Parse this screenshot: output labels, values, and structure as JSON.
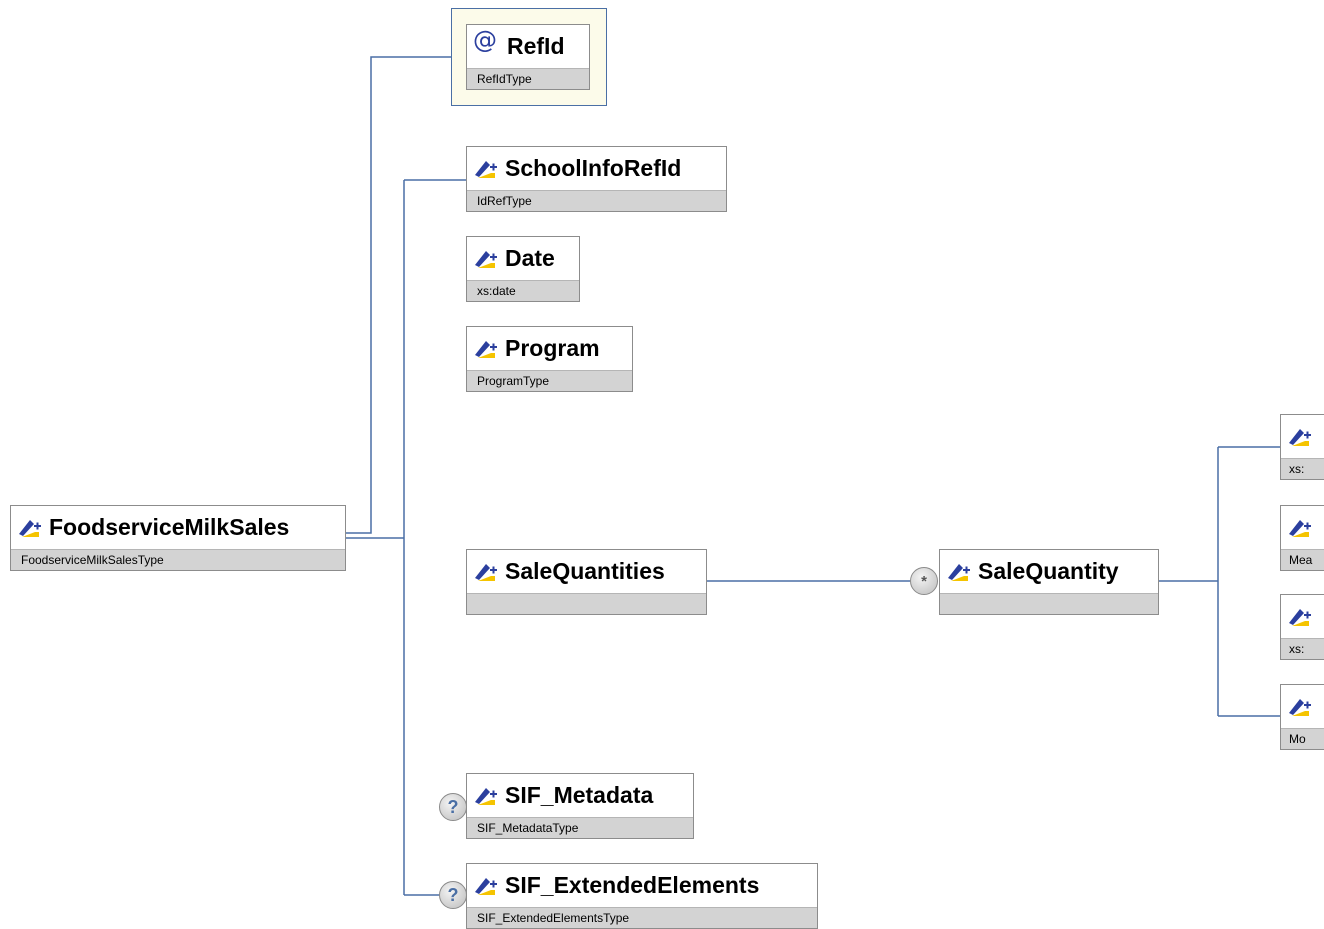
{
  "root": {
    "name": "FoodserviceMilkSales",
    "type": "FoodserviceMilkSalesType"
  },
  "attributes": [
    {
      "name": "RefId",
      "type": "RefIdType"
    }
  ],
  "children": [
    {
      "name": "SchoolInfoRefId",
      "type": "IdRefType"
    },
    {
      "name": "Date",
      "type": "xs:date"
    },
    {
      "name": "Program",
      "type": "ProgramType"
    },
    {
      "name": "SaleQuantities",
      "type": ""
    },
    {
      "name": "SIF_Metadata",
      "type": "SIF_MetadataType",
      "occurrence": "?"
    },
    {
      "name": "SIF_ExtendedElements",
      "type": "SIF_ExtendedElementsType",
      "occurrence": "?"
    }
  ],
  "sale_quantity": {
    "name": "SaleQuantity",
    "type": "",
    "occurrence": "*"
  },
  "sale_quantity_children": [
    {
      "name": "",
      "type": "xs:"
    },
    {
      "name": "",
      "type": "Mea"
    },
    {
      "name": "",
      "type": "xs:"
    },
    {
      "name": "",
      "type": "Mo"
    }
  ],
  "colors": {
    "connector": "#4a6fa5",
    "node_border": "#8c8c8c",
    "type_band": "#d3d3d3",
    "attribute_background": "#fcfbea",
    "icon_blue": "#2b3f9e",
    "icon_yellow": "#f5c400"
  }
}
